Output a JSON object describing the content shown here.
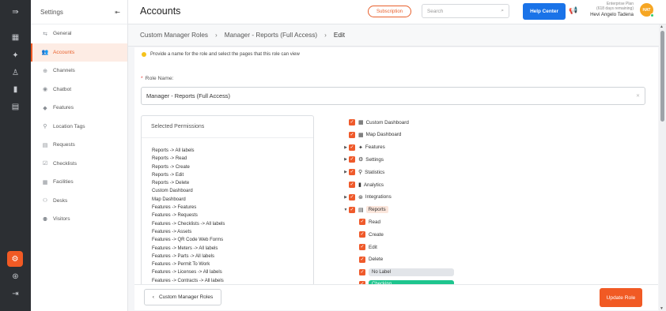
{
  "rail": {
    "icons": [
      "expand-icon",
      "dashboard-icon",
      "features-icon",
      "statistics-icon",
      "analytics-icon",
      "documents-icon",
      "settings-icon",
      "integrations-icon",
      "logout-icon"
    ]
  },
  "sidebar": {
    "title": "Settings",
    "collapse_icon": "collapse-icon",
    "items": [
      {
        "label": "General",
        "icon": "⇆",
        "name": "general"
      },
      {
        "label": "Accounts",
        "icon": "👥",
        "name": "accounts",
        "active": true
      },
      {
        "label": "Channels",
        "icon": "⊕",
        "name": "channels"
      },
      {
        "label": "Chatbot",
        "icon": "◉",
        "name": "chatbot"
      },
      {
        "label": "Features",
        "icon": "◆",
        "name": "features"
      },
      {
        "label": "Location Tags",
        "icon": "⚲",
        "name": "location-tags"
      },
      {
        "label": "Requests",
        "icon": "▤",
        "name": "requests"
      },
      {
        "label": "Checklists",
        "icon": "☑",
        "name": "checklists"
      },
      {
        "label": "Facilities",
        "icon": "▦",
        "name": "facilities"
      },
      {
        "label": "Desks",
        "icon": "⚇",
        "name": "desks"
      },
      {
        "label": "Visitors",
        "icon": "⚉",
        "name": "visitors"
      }
    ]
  },
  "header": {
    "title": "Accounts",
    "subscription_label": "Subscription",
    "search_placeholder": "Search",
    "help_label": "Help Center",
    "plan_line1": "Enterprise Plan",
    "plan_line2": "(618 days remaining)",
    "user_name": "Hevi Angelo Tadena",
    "avatar_initials": "HAT"
  },
  "breadcrumb": {
    "root": "Custom Manager Roles",
    "parent": "Manager - Reports (Full Access)",
    "current": "Edit"
  },
  "form": {
    "info_text": "Provide a name for the role and select the pages that this role can view",
    "role_label": "Role Name",
    "role_value": "Manager - Reports (Full Access)"
  },
  "selected_permissions": {
    "title": "Selected Permissions",
    "items": [
      "Reports -> All labels",
      "Reports -> Read",
      "Reports -> Create",
      "Reports -> Edit",
      "Reports -> Delete",
      "Custom Dashboard",
      "Map Dashboard",
      "Features -> Features",
      "Features -> Requests",
      "Features -> Checklists -> All labels",
      "Features -> Assets",
      "Features -> QR Code Web Forms",
      "Features -> Meters -> All labels",
      "Features -> Parts -> All labels",
      "Features -> Permit To Work",
      "Features -> Licenses -> All labels",
      "Features -> Contracts -> All labels"
    ]
  },
  "tree": {
    "nodes": [
      {
        "label": "Custom Dashboard",
        "icon": "▦",
        "arrow": "",
        "level": 0
      },
      {
        "label": "Map Dashboard",
        "icon": "▦",
        "arrow": "",
        "level": 0
      },
      {
        "label": "Features",
        "icon": "✦",
        "arrow": "▶",
        "level": 0
      },
      {
        "label": "Settings",
        "icon": "⚙",
        "arrow": "▶",
        "level": 0
      },
      {
        "label": "Statistics",
        "icon": "⚲",
        "arrow": "▶",
        "level": 0
      },
      {
        "label": "Analytics",
        "icon": "▮",
        "arrow": "",
        "level": 0
      },
      {
        "label": "Integrations",
        "icon": "⊛",
        "arrow": "▶",
        "level": 0
      },
      {
        "label": "Reports",
        "icon": "▤",
        "arrow": "▼",
        "level": 0,
        "highlight": true
      },
      {
        "label": "Read",
        "level": 1
      },
      {
        "label": "Create",
        "level": 1
      },
      {
        "label": "Edit",
        "level": 1
      },
      {
        "label": "Delete",
        "level": 1
      },
      {
        "label": "No Label",
        "level": 1,
        "pill": "grey"
      },
      {
        "label": "Checking",
        "level": 1,
        "pill": "green"
      }
    ]
  },
  "footer": {
    "back_label": "Custom Manager Roles",
    "update_label": "Update Role"
  },
  "colors": {
    "accent": "#f15a24",
    "help_blue": "#1a73e8",
    "rail": "#2c2f33",
    "pill_green": "#1ec58e"
  }
}
